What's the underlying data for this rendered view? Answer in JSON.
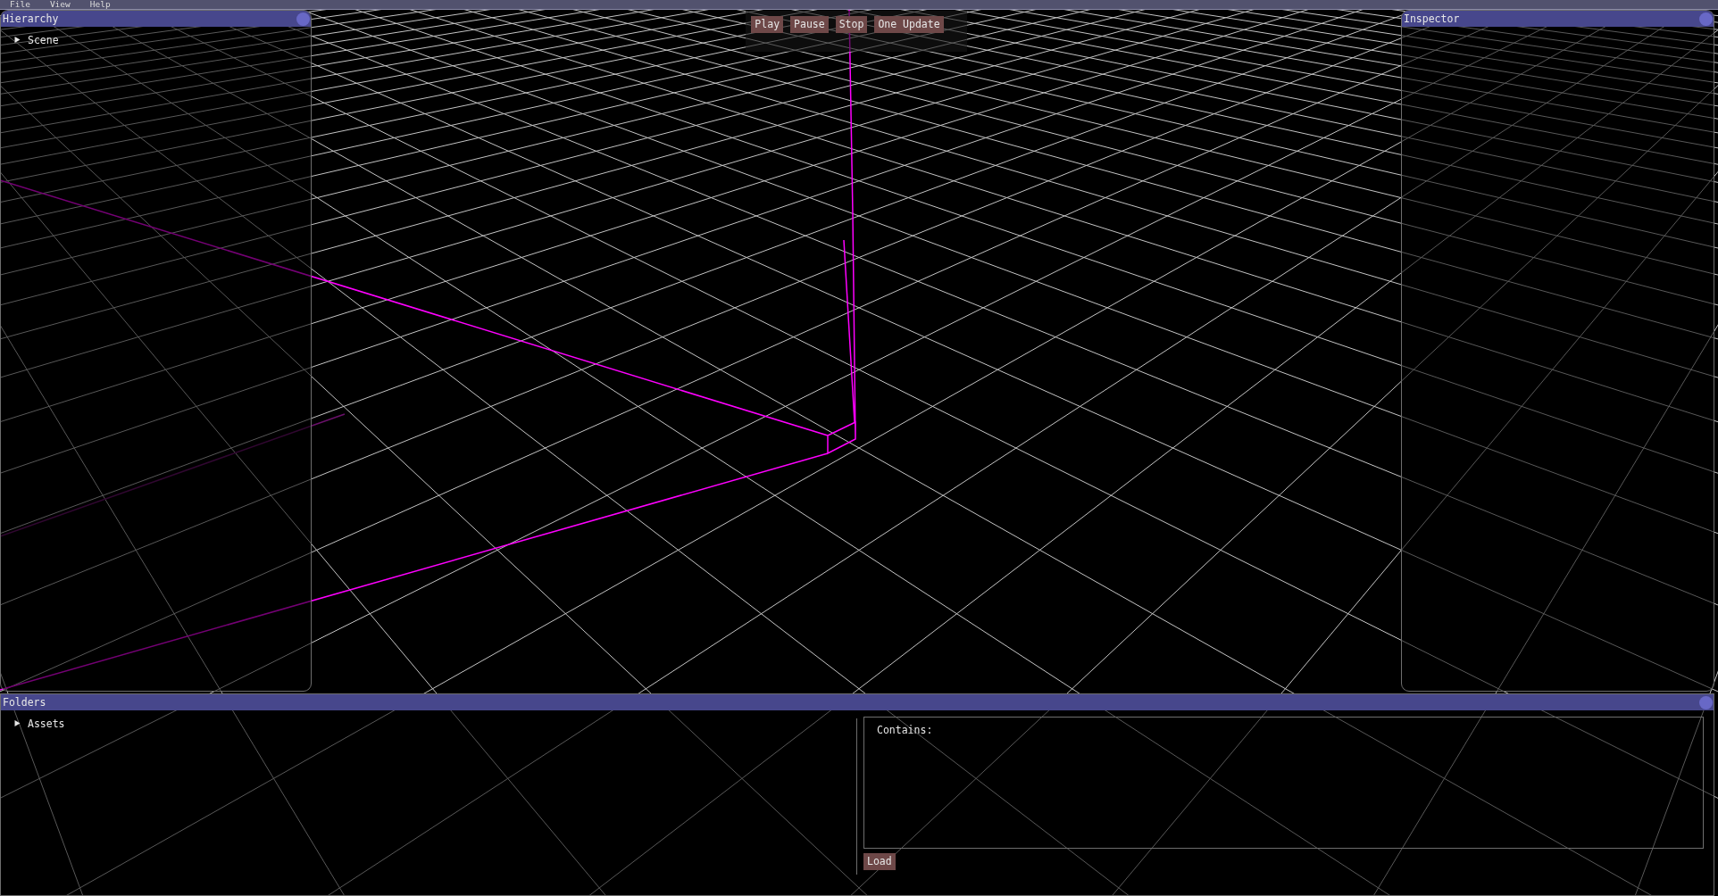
{
  "menu_bar": {
    "items": [
      "File",
      "View",
      "Help"
    ]
  },
  "hierarchy": {
    "title": "Hierarchy",
    "tree": [
      {
        "label": "Scene",
        "expanded": false,
        "selected": false
      }
    ]
  },
  "toolbar": {
    "buttons": [
      "Play",
      "Pause",
      "Stop",
      "One Update"
    ]
  },
  "inspector": {
    "title": "Inspector"
  },
  "folders": {
    "title": "Folders",
    "tree": [
      {
        "label": "Assets",
        "expanded": false,
        "selected": false
      }
    ],
    "contents_label": "Contains:",
    "buttons": [
      "Load"
    ]
  }
}
